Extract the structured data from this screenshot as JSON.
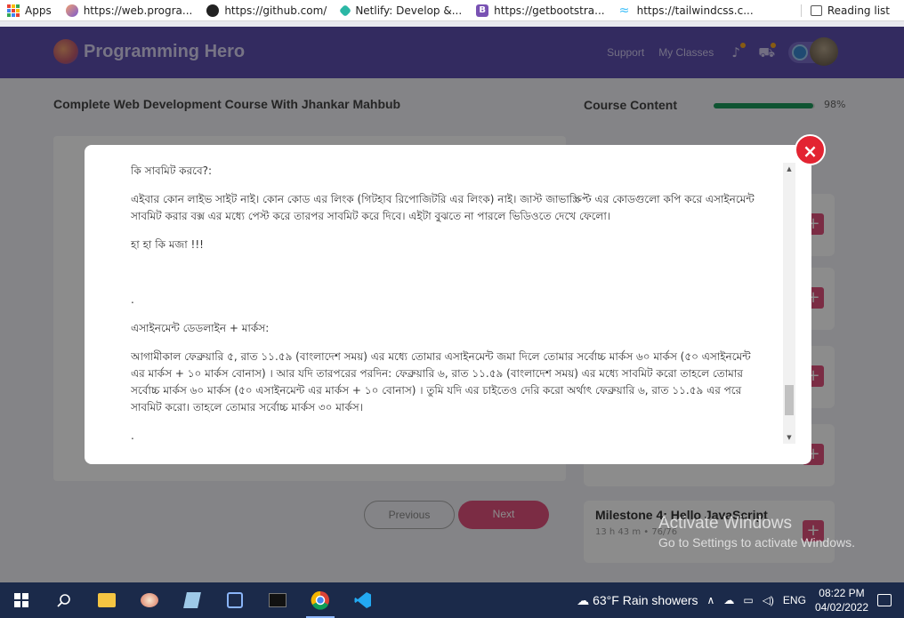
{
  "bookmarks": [
    {
      "label": "Apps",
      "icon": "apps-grid-icon"
    },
    {
      "label": "https://web.progra...",
      "icon": "programming-hero-icon"
    },
    {
      "label": "https://github.com/",
      "icon": "github-icon"
    },
    {
      "label": "Netlify: Develop &...",
      "icon": "netlify-icon"
    },
    {
      "label": "https://getbootstra...",
      "icon": "bootstrap-icon"
    },
    {
      "label": "https://tailwindcss.c...",
      "icon": "tailwind-icon"
    }
  ],
  "reading_list": "Reading list",
  "header": {
    "brand": "Programming Hero",
    "support": "Support",
    "my_classes": "My Classes",
    "gem_count": "71"
  },
  "course": {
    "title": "Complete Web Development Course With Jhankar Mahbub",
    "content_title": "Course Content",
    "progress_percent": 98,
    "progress_label": "98%",
    "prev": "Previous",
    "next": "Next",
    "milestone_name": "Milestone 4: Hello JavaScript",
    "milestone_meta": "13 h 43 m •  76/76"
  },
  "modal": {
    "p1": "কি সাবমিট করবে?:",
    "p2": "এইবার কোন লাইভ সাইট নাই। কোন কোড এর লিংক (গিটহাব রিপোজিটরি এর লিংক) নাই। জাস্ট জাভাস্ক্রিপ্ট এর কোডগুলো কপি করে এসাইনমেন্ট সাবমিট করার বক্স এর মধ্যে পেস্ট করে তারপর সাবমিট করে দিবে। এইটা বুঝতে না পারলে ভিডিওতে দেখে ফেলো।",
    "p3": "হা হা কি মজা !!!",
    "dot1": ".",
    "p4": "এসাইনমেন্ট ডেডলাইন + মার্কস:",
    "p5": "আগামীকাল ফেব্রুয়ারি ৫, রাত ১১.৫৯ (বাংলাদেশ সময়) এর মধ্যে তোমার এসাইনমেন্ট জমা দিলে তোমার সর্বোচ্চ মার্কস ৬০ মার্কস (৫০ এসাইনমেন্ট এর মার্কস + ১০ মার্কস বোনাস) । আর যদি তারপরের পরদিন: ফেব্রুয়ারি ৬, রাত ১১.৫৯ (বাংলাদেশ সময়) এর মধ্যে সাবমিট করো তাহলে তোমার সর্বোচ্চ মার্কস ৬০ মার্কস (৫০ এসাইনমেন্ট এর মার্কস + ১০ বোনাস) । তুমি যদি এর চাইতেও দেরি করো অর্থাৎ ফেব্রুয়ারি ৬, রাত ১১.৫৯ এর পরে সাবমিট করো। তাহলে তোমার সর্বোচ্চ মার্কস ৩০ মার্কস।",
    "dot2": ".",
    "close": "×"
  },
  "watermark": {
    "line1": "Activate Windows",
    "line2": "Go to Settings to activate Windows."
  },
  "taskbar": {
    "weather": "63°F  Rain showers",
    "lang": "ENG",
    "time": "08:22 PM",
    "date": "04/02/2022"
  }
}
